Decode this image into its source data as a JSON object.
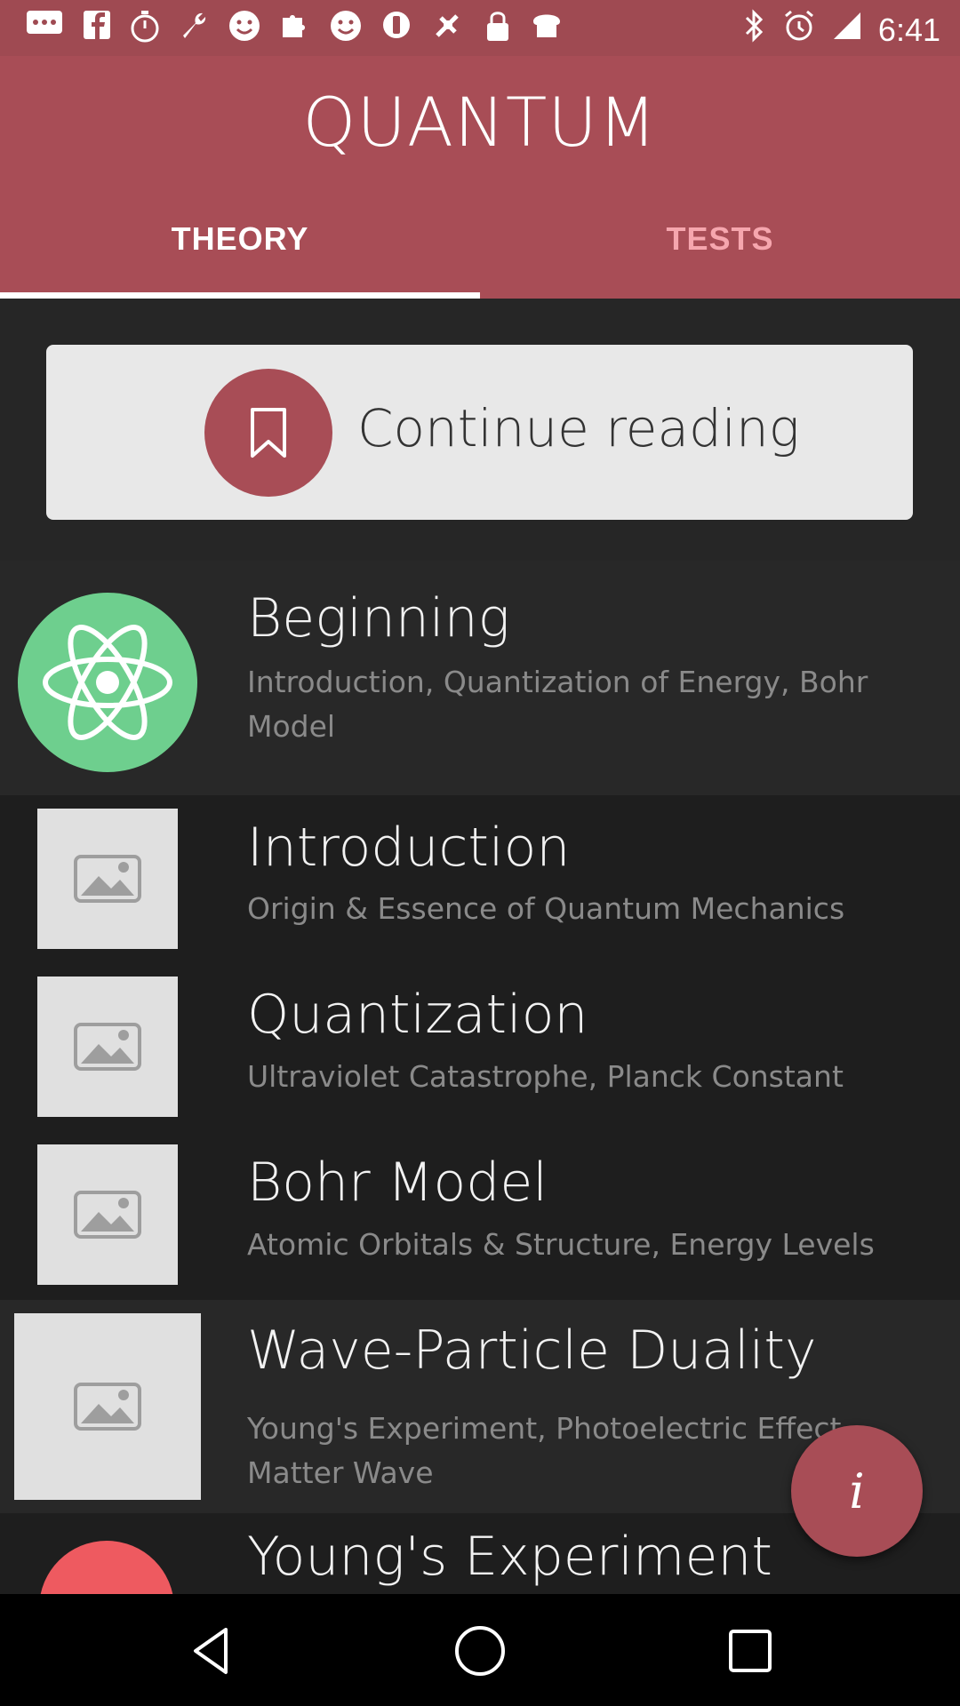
{
  "status_bar": {
    "time": "6:41",
    "left_icons": [
      "message-icon",
      "facebook-icon",
      "timer-icon",
      "wrench-icon",
      "smiley-icon",
      "puzzle-icon",
      "smiley-icon",
      "vibrate-icon",
      "fake-gps-icon",
      "lock-icon",
      "toast-icon"
    ],
    "right_icons": [
      "bluetooth-icon",
      "alarm-icon",
      "signal-icon"
    ]
  },
  "header": {
    "title": "QUANTUM",
    "tabs": [
      {
        "label": "THEORY",
        "selected": true
      },
      {
        "label": "TESTS",
        "selected": false
      }
    ]
  },
  "continue_reading": {
    "label": "Continue reading",
    "icon": "bookmark-icon"
  },
  "sections": [
    {
      "title": "Beginning",
      "subtitle": "Introduction, Quantization of Energy, Bohr Model",
      "icon": "atom-icon",
      "lessons": [
        {
          "title": "Introduction",
          "subtitle": "Origin & Essence of Quantum Mechanics",
          "icon": "image-placeholder-icon"
        },
        {
          "title": "Quantization",
          "subtitle": "Ultraviolet Catastrophe, Planck Constant",
          "icon": "image-placeholder-icon"
        },
        {
          "title": "Bohr Model",
          "subtitle": "Atomic Orbitals & Structure, Energy Levels",
          "icon": "image-placeholder-icon"
        }
      ]
    },
    {
      "title": "Wave-Particle Duality",
      "subtitle": "Young's Experiment, Photoelectric Effect, Matter Wave",
      "icon": "image-placeholder-icon"
    },
    {
      "title": "Young's Experiment",
      "icon": "partial-circle-icon"
    }
  ],
  "fab": {
    "label": "i",
    "icon": "info-icon"
  },
  "colors": {
    "accent": "#a84d56",
    "status_bar": "#9f4a52",
    "atom_bg": "#6ecf8e",
    "content_bg": "#262626"
  },
  "nav": [
    "back-icon",
    "home-icon",
    "recents-icon"
  ]
}
